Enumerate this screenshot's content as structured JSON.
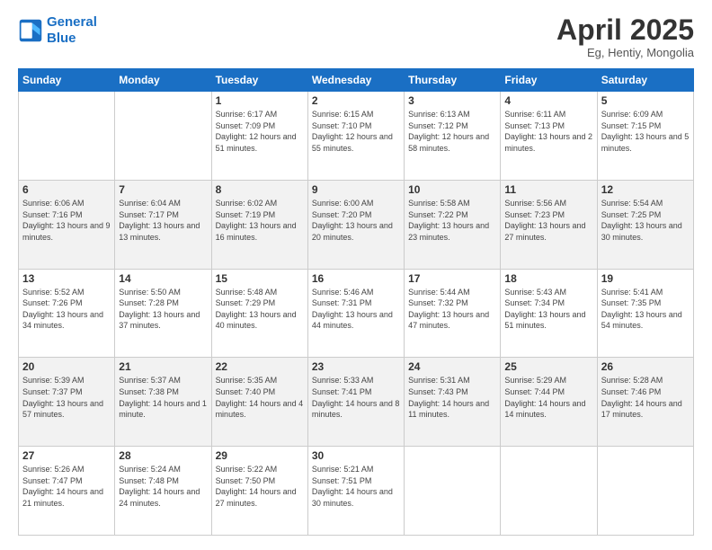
{
  "logo": {
    "line1": "General",
    "line2": "Blue"
  },
  "title": "April 2025",
  "subtitle": "Eg, Hentiy, Mongolia",
  "days_of_week": [
    "Sunday",
    "Monday",
    "Tuesday",
    "Wednesday",
    "Thursday",
    "Friday",
    "Saturday"
  ],
  "weeks": [
    [
      {
        "day": "",
        "sunrise": "",
        "sunset": "",
        "daylight": ""
      },
      {
        "day": "",
        "sunrise": "",
        "sunset": "",
        "daylight": ""
      },
      {
        "day": "1",
        "sunrise": "Sunrise: 6:17 AM",
        "sunset": "Sunset: 7:09 PM",
        "daylight": "Daylight: 12 hours and 51 minutes."
      },
      {
        "day": "2",
        "sunrise": "Sunrise: 6:15 AM",
        "sunset": "Sunset: 7:10 PM",
        "daylight": "Daylight: 12 hours and 55 minutes."
      },
      {
        "day": "3",
        "sunrise": "Sunrise: 6:13 AM",
        "sunset": "Sunset: 7:12 PM",
        "daylight": "Daylight: 12 hours and 58 minutes."
      },
      {
        "day": "4",
        "sunrise": "Sunrise: 6:11 AM",
        "sunset": "Sunset: 7:13 PM",
        "daylight": "Daylight: 13 hours and 2 minutes."
      },
      {
        "day": "5",
        "sunrise": "Sunrise: 6:09 AM",
        "sunset": "Sunset: 7:15 PM",
        "daylight": "Daylight: 13 hours and 5 minutes."
      }
    ],
    [
      {
        "day": "6",
        "sunrise": "Sunrise: 6:06 AM",
        "sunset": "Sunset: 7:16 PM",
        "daylight": "Daylight: 13 hours and 9 minutes."
      },
      {
        "day": "7",
        "sunrise": "Sunrise: 6:04 AM",
        "sunset": "Sunset: 7:17 PM",
        "daylight": "Daylight: 13 hours and 13 minutes."
      },
      {
        "day": "8",
        "sunrise": "Sunrise: 6:02 AM",
        "sunset": "Sunset: 7:19 PM",
        "daylight": "Daylight: 13 hours and 16 minutes."
      },
      {
        "day": "9",
        "sunrise": "Sunrise: 6:00 AM",
        "sunset": "Sunset: 7:20 PM",
        "daylight": "Daylight: 13 hours and 20 minutes."
      },
      {
        "day": "10",
        "sunrise": "Sunrise: 5:58 AM",
        "sunset": "Sunset: 7:22 PM",
        "daylight": "Daylight: 13 hours and 23 minutes."
      },
      {
        "day": "11",
        "sunrise": "Sunrise: 5:56 AM",
        "sunset": "Sunset: 7:23 PM",
        "daylight": "Daylight: 13 hours and 27 minutes."
      },
      {
        "day": "12",
        "sunrise": "Sunrise: 5:54 AM",
        "sunset": "Sunset: 7:25 PM",
        "daylight": "Daylight: 13 hours and 30 minutes."
      }
    ],
    [
      {
        "day": "13",
        "sunrise": "Sunrise: 5:52 AM",
        "sunset": "Sunset: 7:26 PM",
        "daylight": "Daylight: 13 hours and 34 minutes."
      },
      {
        "day": "14",
        "sunrise": "Sunrise: 5:50 AM",
        "sunset": "Sunset: 7:28 PM",
        "daylight": "Daylight: 13 hours and 37 minutes."
      },
      {
        "day": "15",
        "sunrise": "Sunrise: 5:48 AM",
        "sunset": "Sunset: 7:29 PM",
        "daylight": "Daylight: 13 hours and 40 minutes."
      },
      {
        "day": "16",
        "sunrise": "Sunrise: 5:46 AM",
        "sunset": "Sunset: 7:31 PM",
        "daylight": "Daylight: 13 hours and 44 minutes."
      },
      {
        "day": "17",
        "sunrise": "Sunrise: 5:44 AM",
        "sunset": "Sunset: 7:32 PM",
        "daylight": "Daylight: 13 hours and 47 minutes."
      },
      {
        "day": "18",
        "sunrise": "Sunrise: 5:43 AM",
        "sunset": "Sunset: 7:34 PM",
        "daylight": "Daylight: 13 hours and 51 minutes."
      },
      {
        "day": "19",
        "sunrise": "Sunrise: 5:41 AM",
        "sunset": "Sunset: 7:35 PM",
        "daylight": "Daylight: 13 hours and 54 minutes."
      }
    ],
    [
      {
        "day": "20",
        "sunrise": "Sunrise: 5:39 AM",
        "sunset": "Sunset: 7:37 PM",
        "daylight": "Daylight: 13 hours and 57 minutes."
      },
      {
        "day": "21",
        "sunrise": "Sunrise: 5:37 AM",
        "sunset": "Sunset: 7:38 PM",
        "daylight": "Daylight: 14 hours and 1 minute."
      },
      {
        "day": "22",
        "sunrise": "Sunrise: 5:35 AM",
        "sunset": "Sunset: 7:40 PM",
        "daylight": "Daylight: 14 hours and 4 minutes."
      },
      {
        "day": "23",
        "sunrise": "Sunrise: 5:33 AM",
        "sunset": "Sunset: 7:41 PM",
        "daylight": "Daylight: 14 hours and 8 minutes."
      },
      {
        "day": "24",
        "sunrise": "Sunrise: 5:31 AM",
        "sunset": "Sunset: 7:43 PM",
        "daylight": "Daylight: 14 hours and 11 minutes."
      },
      {
        "day": "25",
        "sunrise": "Sunrise: 5:29 AM",
        "sunset": "Sunset: 7:44 PM",
        "daylight": "Daylight: 14 hours and 14 minutes."
      },
      {
        "day": "26",
        "sunrise": "Sunrise: 5:28 AM",
        "sunset": "Sunset: 7:46 PM",
        "daylight": "Daylight: 14 hours and 17 minutes."
      }
    ],
    [
      {
        "day": "27",
        "sunrise": "Sunrise: 5:26 AM",
        "sunset": "Sunset: 7:47 PM",
        "daylight": "Daylight: 14 hours and 21 minutes."
      },
      {
        "day": "28",
        "sunrise": "Sunrise: 5:24 AM",
        "sunset": "Sunset: 7:48 PM",
        "daylight": "Daylight: 14 hours and 24 minutes."
      },
      {
        "day": "29",
        "sunrise": "Sunrise: 5:22 AM",
        "sunset": "Sunset: 7:50 PM",
        "daylight": "Daylight: 14 hours and 27 minutes."
      },
      {
        "day": "30",
        "sunrise": "Sunrise: 5:21 AM",
        "sunset": "Sunset: 7:51 PM",
        "daylight": "Daylight: 14 hours and 30 minutes."
      },
      {
        "day": "",
        "sunrise": "",
        "sunset": "",
        "daylight": ""
      },
      {
        "day": "",
        "sunrise": "",
        "sunset": "",
        "daylight": ""
      },
      {
        "day": "",
        "sunrise": "",
        "sunset": "",
        "daylight": ""
      }
    ]
  ]
}
